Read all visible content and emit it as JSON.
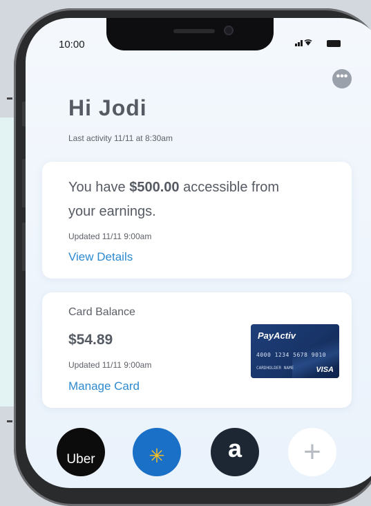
{
  "status_bar": {
    "time": "10:00",
    "signal_text": "▐▐▌ ◉"
  },
  "header": {
    "more_glyph": "•••",
    "greeting": "Hi Jodi",
    "last_activity": "Last activity 11/11 at 8:30am"
  },
  "earnings_card": {
    "line1_prefix": "You have ",
    "amount": "$500.00",
    "line1_suffix": " accessible from",
    "line2": "your earnings.",
    "updated": "Updated 11/11 9:00am",
    "link": "View Details"
  },
  "balance_card": {
    "label": "Card Balance",
    "value": "$54.89",
    "updated": "Updated 11/11 9:00am",
    "link": "Manage Card",
    "card_image": {
      "brand": "PayActiv",
      "number": "4000 1234 5678 9010",
      "holder": "CARDHOLDER NAME",
      "network": "VISA"
    }
  },
  "shortcuts": [
    {
      "name": "Uber",
      "label": "Uber"
    },
    {
      "name": "Walmart",
      "label": "✳"
    },
    {
      "name": "Amazon",
      "label": "a"
    },
    {
      "name": "Add",
      "label": "+"
    }
  ],
  "colors": {
    "accent_link": "#2d8ad0",
    "text": "#555a63",
    "background": "#eaf2fb"
  }
}
